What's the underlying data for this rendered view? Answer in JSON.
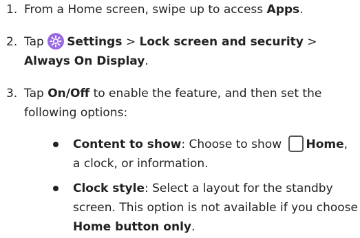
{
  "steps": [
    {
      "number": "1.",
      "t1": "From a Home screen, swipe up to access ",
      "b1": "Apps",
      "t2": "."
    },
    {
      "number": "2.",
      "t1": "Tap ",
      "icon": "settings-gear-icon",
      "b1": "Settings",
      "t2": " > ",
      "b2": "Lock screen and security",
      "t3": " >",
      "b3": "Always On Display",
      "t4": "."
    },
    {
      "number": "3.",
      "t1": "Tap ",
      "b1": "On/Off",
      "t2": " to enable the feature, and then set the",
      "t3": "following options:"
    }
  ],
  "bullets": [
    {
      "b1": "Content to show",
      "t1": ": Choose to show ",
      "icon": "home-button-icon",
      "b2": "Home",
      "t2": ",",
      "t3": "a clock, or information."
    },
    {
      "b1": "Clock style",
      "t1": ": Select a layout for the standby",
      "t2": "screen. This option is not available if you choose",
      "b2": "Home button only",
      "t3": "."
    }
  ],
  "colors": {
    "text": "#222222",
    "settings_icon_bg": "#9a6be0"
  }
}
